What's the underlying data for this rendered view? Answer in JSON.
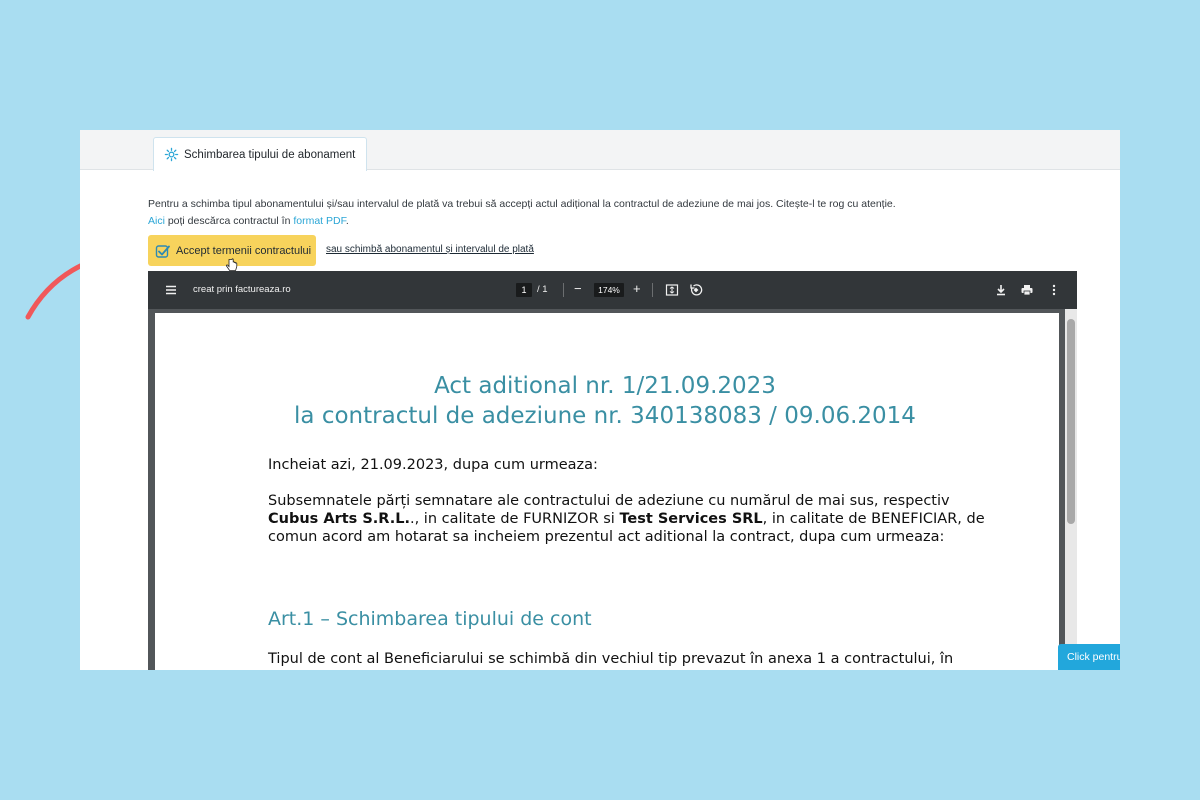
{
  "tab": {
    "label": "Schimbarea tipului de abonament"
  },
  "intro": {
    "line1": "Pentru a schimba tipul abonamentului și/sau intervalul de plată va trebui să accepți actul adițional la contractul de adeziune de mai jos. Citește-l te rog cu atenție.",
    "download_link": "Aici",
    "line2_middle": " poți descărca contractul în ",
    "format_link": "format PDF",
    "line2_end": "."
  },
  "actions": {
    "accept_label": "Accept termenii contractului",
    "alt_link": "sau schimbă abonamentul și intervalul de plată"
  },
  "viewer": {
    "title": "creat prin factureaza.ro",
    "page_current": "1",
    "page_separator": "/",
    "page_total": "1",
    "zoom_minus": "−",
    "zoom": "174%",
    "zoom_plus": "+"
  },
  "document": {
    "title_line1": "Act aditional nr. 1/21.09.2023",
    "title_line2": "la contractul de adeziune nr. 340138083 / 09.06.2014",
    "date_line": "Incheiat azi, 21.09.2023, dupa cum urmeaza:",
    "para1_line1": "Subsemnatele părți semnatare ale contractului de adeziune cu numărul de mai sus, respectiv",
    "party1": "Cubus Arts S.R.L.",
    "para1_mid": "., in calitate de FURNIZOR si ",
    "party2": "Test Services SRL",
    "para1_end": ", in calitate de BENEFICIAR, de",
    "para1_line3": "comun acord am hotarat sa incheiem prezentul act aditional la contract, dupa cum urmeaza:",
    "art1_heading": "Art.1 – Schimbarea tipului de cont",
    "art1_text": "Tipul de cont al Beneficiarului se schimbă din vechiul tip  prevazut în anexa 1 a contractului, în"
  },
  "help_button": "Click pentru",
  "colors": {
    "background": "#a9ddf1",
    "accent_yellow": "#f7d35c",
    "heading_teal": "#3a8fa3",
    "link_blue": "#2ba6d6",
    "arrow_red": "#f0585a"
  },
  "icons": {
    "tab": "gear-icon",
    "accept": "checkbox-check-icon",
    "menu": "hamburger-menu-icon",
    "fit": "fit-page-icon",
    "rotate": "rotate-icon",
    "download": "download-icon",
    "print": "print-icon",
    "more": "more-vertical-icon"
  }
}
